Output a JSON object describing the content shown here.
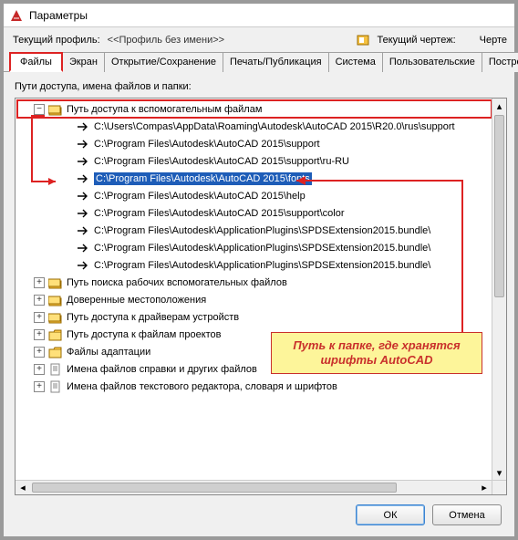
{
  "window": {
    "title": "Параметры"
  },
  "profile": {
    "label": "Текущий профиль:",
    "value": "<<Профиль без имени>>",
    "drawing_label": "Текущий чертеж:",
    "drawing_value": "Черте"
  },
  "tabs": {
    "items": [
      {
        "label": "Файлы",
        "active": true
      },
      {
        "label": "Экран"
      },
      {
        "label": "Открытие/Сохранение"
      },
      {
        "label": "Печать/Публикация"
      },
      {
        "label": "Система"
      },
      {
        "label": "Пользовательские"
      },
      {
        "label": "Постро"
      }
    ]
  },
  "section_label": "Пути доступа, имена файлов и папки:",
  "tree": {
    "root": {
      "label": "Путь доступа к вспомогательным файлам",
      "expanded": true,
      "children": [
        {
          "label": "C:\\Users\\Compas\\AppData\\Roaming\\Autodesk\\AutoCAD 2015\\R20.0\\rus\\support"
        },
        {
          "label": "C:\\Program Files\\Autodesk\\AutoCAD 2015\\support"
        },
        {
          "label": "C:\\Program Files\\Autodesk\\AutoCAD 2015\\support\\ru-RU"
        },
        {
          "label": "C:\\Program Files\\Autodesk\\AutoCAD 2015\\fonts",
          "highlighted": true
        },
        {
          "label": "C:\\Program Files\\Autodesk\\AutoCAD 2015\\help"
        },
        {
          "label": "C:\\Program Files\\Autodesk\\AutoCAD 2015\\support\\color"
        },
        {
          "label": "C:\\Program Files\\Autodesk\\ApplicationPlugins\\SPDSExtension2015.bundle\\"
        },
        {
          "label": "C:\\Program Files\\Autodesk\\ApplicationPlugins\\SPDSExtension2015.bundle\\"
        },
        {
          "label": "C:\\Program Files\\Autodesk\\ApplicationPlugins\\SPDSExtension2015.bundle\\"
        }
      ]
    },
    "siblings": [
      {
        "label": "Путь поиска рабочих вспомогательных файлов"
      },
      {
        "label": "Доверенные местоположения"
      },
      {
        "label": "Путь доступа к драйверам устройств"
      },
      {
        "label": "Путь доступа к файлам проектов"
      },
      {
        "label": "Файлы адаптации"
      },
      {
        "label": "Имена файлов справки и других файлов"
      },
      {
        "label": "Имена файлов текстового редактора, словаря и шрифтов"
      }
    ]
  },
  "annotation": {
    "text": "Путь к папке, где хранятся шрифты AutoCAD"
  },
  "buttons": {
    "ok": "ОК",
    "cancel": "Отмена"
  },
  "colors": {
    "accent_red": "#d22",
    "highlight_blue": "#1e5db8",
    "note_bg": "#fdf59a"
  }
}
